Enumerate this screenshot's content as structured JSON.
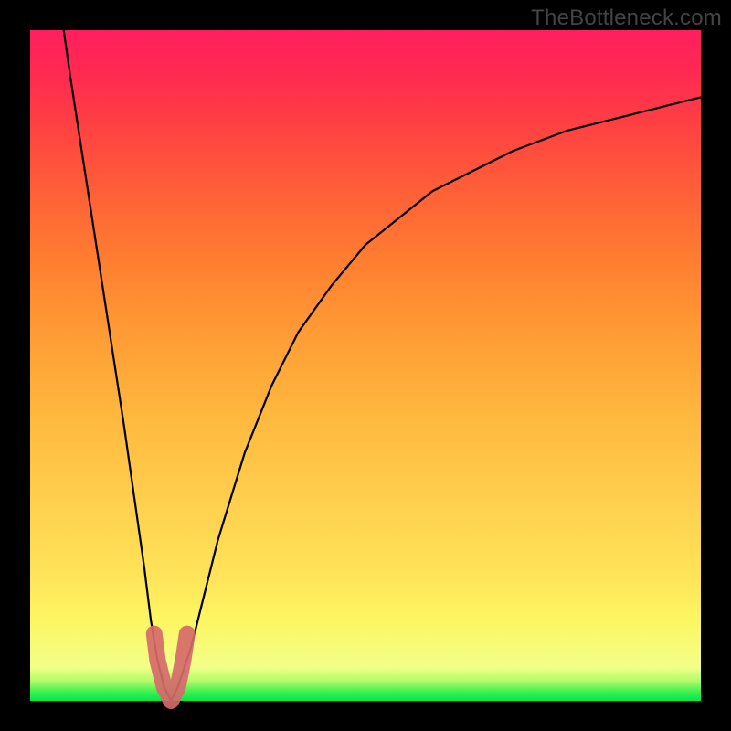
{
  "watermark": "TheBottleneck.com",
  "chart_data": {
    "type": "line",
    "title": "",
    "xlabel": "",
    "ylabel": "",
    "xlim": [
      0,
      100
    ],
    "ylim": [
      0,
      100
    ],
    "series": [
      {
        "name": "bottleneck-curve",
        "x": [
          5,
          6,
          8,
          10,
          12,
          14,
          15,
          16,
          17,
          18,
          19,
          20,
          21,
          22,
          24,
          26,
          28,
          32,
          36,
          40,
          45,
          50,
          55,
          60,
          66,
          72,
          80,
          88,
          96,
          100
        ],
        "values": [
          100,
          93,
          80,
          67,
          54,
          41,
          34,
          27,
          20,
          12,
          6,
          2,
          0,
          2,
          8,
          16,
          24,
          37,
          47,
          55,
          62,
          68,
          72,
          76,
          79,
          82,
          85,
          87,
          89,
          90
        ]
      },
      {
        "name": "highlight-nub",
        "x": [
          18.5,
          19,
          20,
          21,
          22,
          22.8,
          23.4
        ],
        "values": [
          10,
          6,
          2,
          0,
          2,
          6,
          10
        ]
      }
    ],
    "annotations": []
  },
  "colors": {
    "curve": "#000000",
    "highlight": "#d56a6a",
    "frame": "#000000"
  }
}
